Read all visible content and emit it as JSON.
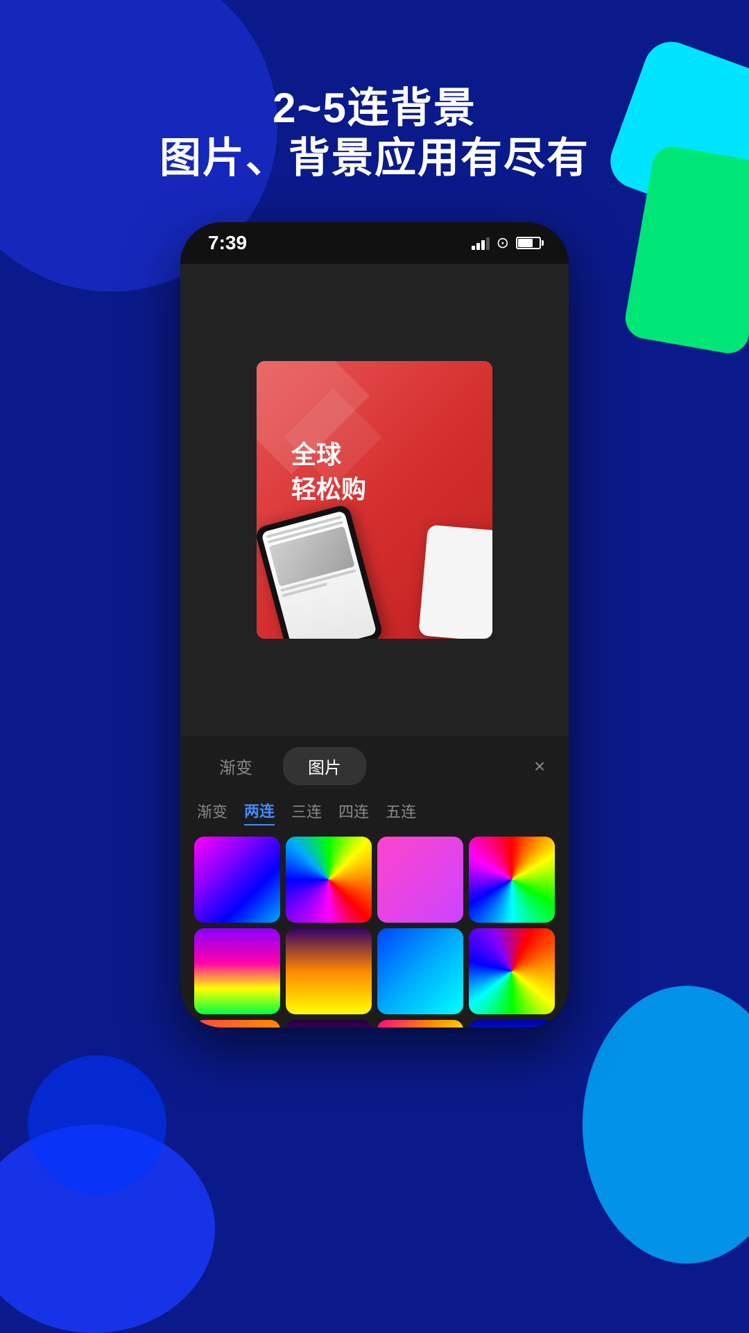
{
  "page": {
    "background_color": "#0a1a8a"
  },
  "header": {
    "line1": "2~5连背景",
    "line2": "图片、背景应用有尽有"
  },
  "status_bar": {
    "time": "7:39",
    "signal_label": "signal",
    "wifi_label": "wifi",
    "battery_label": "battery"
  },
  "image_card": {
    "text_line1": "全球",
    "text_line2": "轻松购"
  },
  "bottom_panel": {
    "tabs": [
      {
        "id": "gradient",
        "label": "渐变",
        "active": false
      },
      {
        "id": "image",
        "label": "图片",
        "active": true
      }
    ],
    "close_label": "×",
    "sub_tabs": [
      {
        "id": "gradient",
        "label": "渐变",
        "active": false
      },
      {
        "id": "two",
        "label": "两连",
        "active": true
      },
      {
        "id": "three",
        "label": "三连",
        "active": false
      },
      {
        "id": "four",
        "label": "四连",
        "active": false
      },
      {
        "id": "five",
        "label": "五连",
        "active": false
      }
    ],
    "color_items": [
      {
        "id": 1,
        "class": "grad-1"
      },
      {
        "id": 2,
        "class": "grad-2"
      },
      {
        "id": 3,
        "class": "grad-3"
      },
      {
        "id": 4,
        "class": "grad-4"
      },
      {
        "id": 5,
        "class": "grad-5"
      },
      {
        "id": 6,
        "class": "grad-6"
      },
      {
        "id": 7,
        "class": "grad-7"
      },
      {
        "id": 8,
        "class": "grad-8"
      },
      {
        "id": 9,
        "class": "grad-row2-1"
      },
      {
        "id": 10,
        "class": "grad-row2-2"
      },
      {
        "id": 11,
        "class": "grad-row2-3"
      },
      {
        "id": 12,
        "class": "grad-row2-4"
      }
    ]
  }
}
